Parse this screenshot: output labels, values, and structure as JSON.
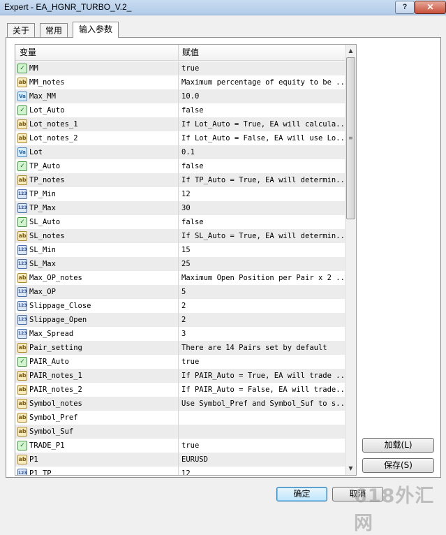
{
  "window": {
    "title": "Expert - EA_HGNR_TURBO_V.2_",
    "help_label": "?",
    "close_label": "✕"
  },
  "tabs": [
    {
      "label": "关于",
      "active": false
    },
    {
      "label": "常用",
      "active": false
    },
    {
      "label": "输入参数",
      "active": true
    }
  ],
  "grid": {
    "col_variable": "变量",
    "col_value": "赋值",
    "rows": [
      {
        "type": "bool",
        "name": "MM",
        "value": "true"
      },
      {
        "type": "string",
        "name": "MM_notes",
        "value": "Maximum percentage of equity to be ..."
      },
      {
        "type": "double",
        "name": "Max_MM",
        "value": "10.0"
      },
      {
        "type": "bool",
        "name": "Lot_Auto",
        "value": "false"
      },
      {
        "type": "string",
        "name": "Lot_notes_1",
        "value": "If Lot_Auto = True, EA will calcula..."
      },
      {
        "type": "string",
        "name": "Lot_notes_2",
        "value": "If Lot_Auto = False, EA will use Lo..."
      },
      {
        "type": "double",
        "name": "Lot",
        "value": "0.1"
      },
      {
        "type": "bool",
        "name": "TP_Auto",
        "value": "false"
      },
      {
        "type": "string",
        "name": "TP_notes",
        "value": "If TP_Auto = True, EA will determin..."
      },
      {
        "type": "int",
        "name": "TP_Min",
        "value": "12"
      },
      {
        "type": "int",
        "name": "TP_Max",
        "value": "30"
      },
      {
        "type": "bool",
        "name": "SL_Auto",
        "value": "false"
      },
      {
        "type": "string",
        "name": "SL_notes",
        "value": "If SL_Auto = True, EA will determin..."
      },
      {
        "type": "int",
        "name": "SL_Min",
        "value": "15"
      },
      {
        "type": "int",
        "name": "SL_Max",
        "value": "25"
      },
      {
        "type": "string",
        "name": "Max_OP_notes",
        "value": "Maximum Open Position per Pair x 2 ..."
      },
      {
        "type": "int",
        "name": "Max_OP",
        "value": "5"
      },
      {
        "type": "int",
        "name": "Slippage_Close",
        "value": "2"
      },
      {
        "type": "int",
        "name": "Slippage_Open",
        "value": "2"
      },
      {
        "type": "int",
        "name": "Max_Spread",
        "value": "3"
      },
      {
        "type": "string",
        "name": "Pair_setting",
        "value": "There are 14 Pairs set by default"
      },
      {
        "type": "bool",
        "name": "PAIR_Auto",
        "value": "true"
      },
      {
        "type": "string",
        "name": "PAIR_notes_1",
        "value": "If PAIR_Auto = True, EA will trade ..."
      },
      {
        "type": "string",
        "name": "PAIR_notes_2",
        "value": "If PAIR_Auto = False, EA will trade..."
      },
      {
        "type": "string",
        "name": "Symbol_notes",
        "value": "Use Symbol_Pref and Symbol_Suf to s..."
      },
      {
        "type": "string",
        "name": "Symbol_Pref",
        "value": ""
      },
      {
        "type": "string",
        "name": "Symbol_Suf",
        "value": ""
      },
      {
        "type": "bool",
        "name": "TRADE_P1",
        "value": "true"
      },
      {
        "type": "string",
        "name": "P1",
        "value": "EURUSD"
      },
      {
        "type": "int",
        "name": "P1_TP",
        "value": "12"
      }
    ]
  },
  "icons": {
    "bool": "✓",
    "string": "ab",
    "double": "Va",
    "int": "123"
  },
  "buttons": {
    "load": "加载(L)",
    "save": "保存(S)",
    "ok": "确定",
    "cancel": "取消"
  },
  "watermark": "618外汇网"
}
